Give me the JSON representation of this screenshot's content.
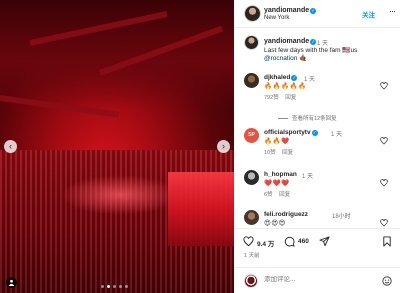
{
  "header": {
    "username": "yandiomande",
    "location": "New York",
    "follow_label": "关注",
    "more_label": "···"
  },
  "caption": {
    "username": "yandiomande",
    "time": "1 天",
    "text": "Last few days with the fam 🇺🇸us",
    "mention": "@rocnation 🤙🏾"
  },
  "comments": [
    {
      "username": "djkhaled",
      "verified": true,
      "time": "1 天",
      "text": "🔥🔥🔥🔥🔥",
      "likes": "792赞",
      "reply": "回复"
    },
    {
      "username": "officialsportytv",
      "verified": true,
      "time": "1 天",
      "text": "🔥🔥❤️",
      "likes": "10赞",
      "reply": "回复"
    },
    {
      "username": "h_hopman",
      "verified": false,
      "time": "1 天",
      "text": "❤️❤️❤️",
      "likes": "6赞",
      "reply": "回复"
    },
    {
      "username": "feli.rodriguezz",
      "verified": false,
      "time": "18小时",
      "text": "😍😍😍",
      "likes": "",
      "reply": ""
    }
  ],
  "view_replies": "查看所有12条回复",
  "actions": {
    "likes_count": "9.4 万",
    "comments_count": "460"
  },
  "post_date": "1 天前",
  "add_comment": {
    "placeholder": "添加评论..."
  },
  "media": {
    "prev_label": "‹",
    "next_label": "›",
    "slide_count": 5,
    "active_slide": 2
  },
  "colors": {
    "accent": "#0095f6",
    "stage_red": "#d71422"
  }
}
